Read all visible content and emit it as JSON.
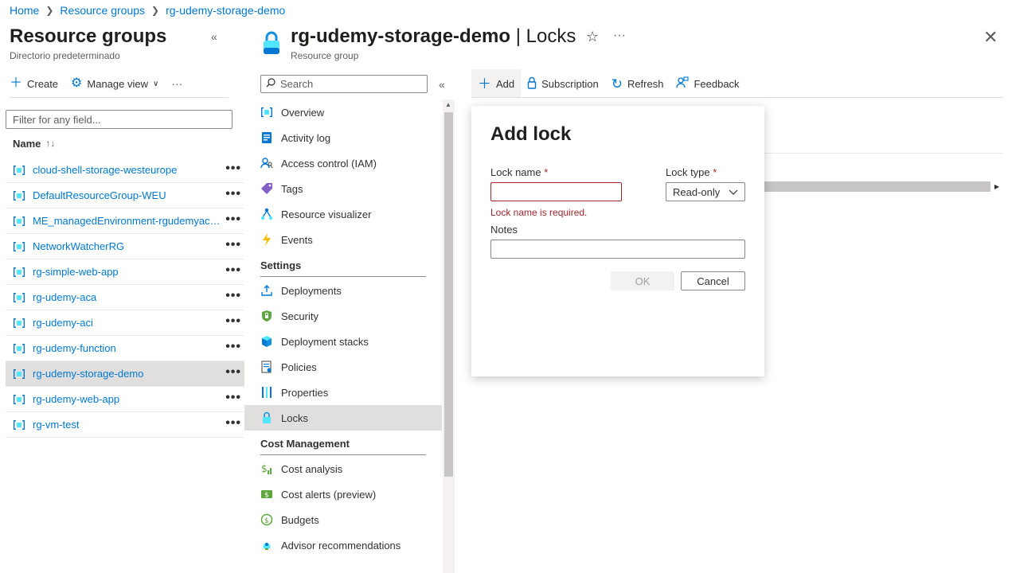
{
  "breadcrumb": [
    "Home",
    "Resource groups",
    "rg-udemy-storage-demo"
  ],
  "left_panel": {
    "title": "Resource groups",
    "subtitle": "Directorio predeterminado",
    "create_label": "Create",
    "manage_view_label": "Manage view",
    "filter_placeholder": "Filter for any field...",
    "column_name": "Name",
    "sort_glyph": "↑↓",
    "items": [
      {
        "name": "cloud-shell-storage-westeurope"
      },
      {
        "name": "DefaultResourceGroup-WEU"
      },
      {
        "name": "ME_managedEnvironment-rgudemyaca-..."
      },
      {
        "name": "NetworkWatcherRG"
      },
      {
        "name": "rg-simple-web-app"
      },
      {
        "name": "rg-udemy-aca"
      },
      {
        "name": "rg-udemy-aci"
      },
      {
        "name": "rg-udemy-function"
      },
      {
        "name": "rg-udemy-storage-demo",
        "selected": true
      },
      {
        "name": "rg-udemy-web-app"
      },
      {
        "name": "rg-vm-test"
      }
    ],
    "more_glyph": "•••"
  },
  "header": {
    "title_main": "rg-udemy-storage-demo",
    "title_suffix": " | Locks",
    "subtitle": "Resource group"
  },
  "nav": {
    "search_placeholder": "Search",
    "items": [
      {
        "label": "Overview",
        "icon": "overview-icon"
      },
      {
        "label": "Activity log",
        "icon": "activity-log-icon"
      },
      {
        "label": "Access control (IAM)",
        "icon": "iam-icon"
      },
      {
        "label": "Tags",
        "icon": "tag-icon"
      },
      {
        "label": "Resource visualizer",
        "icon": "visualizer-icon"
      },
      {
        "label": "Events",
        "icon": "lightning-icon"
      }
    ],
    "settings_heading": "Settings",
    "settings_items": [
      {
        "label": "Deployments",
        "icon": "deploy-icon"
      },
      {
        "label": "Security",
        "icon": "shield-icon"
      },
      {
        "label": "Deployment stacks",
        "icon": "cube-icon"
      },
      {
        "label": "Policies",
        "icon": "policy-icon"
      },
      {
        "label": "Properties",
        "icon": "properties-icon"
      },
      {
        "label": "Locks",
        "icon": "lock-icon",
        "selected": true
      }
    ],
    "cost_heading": "Cost Management",
    "cost_items": [
      {
        "label": "Cost analysis",
        "icon": "cost-analysis-icon"
      },
      {
        "label": "Cost alerts (preview)",
        "icon": "cost-alert-icon"
      },
      {
        "label": "Budgets",
        "icon": "budget-icon"
      },
      {
        "label": "Advisor recommendations",
        "icon": "advisor-icon"
      }
    ]
  },
  "toolbar": {
    "add": "Add",
    "subscription": "Subscription",
    "refresh": "Refresh",
    "feedback": "Feedback"
  },
  "dialog": {
    "title": "Add lock",
    "lock_name_label": "Lock name",
    "lock_name_value": "",
    "required_mark": "*",
    "error": "Lock name is required.",
    "lock_type_label": "Lock type",
    "lock_type_value": "Read-only",
    "notes_label": "Notes",
    "notes_value": "",
    "ok": "OK",
    "cancel": "Cancel"
  },
  "colors": {
    "accent": "#0078d4",
    "error": "#a4262c",
    "selected_bg": "#e1dfdd"
  }
}
